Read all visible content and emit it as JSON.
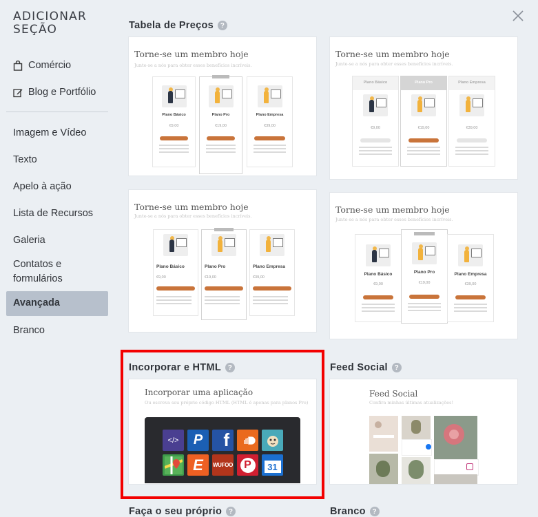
{
  "sidebar": {
    "title_line1": "ADICIONAR",
    "title_line2": "SEÇÃO",
    "links": [
      "Comércio",
      "Blog e Portfólio"
    ],
    "items": [
      "Imagem e Vídeo",
      "Texto",
      "Apelo à ação",
      "Lista de Recursos",
      "Galeria",
      "Contatos e formulários",
      "Avançada",
      "Branco"
    ],
    "active": "Avançada"
  },
  "sections": {
    "pricing": "Tabela de Preços",
    "embed": "Incorporar e HTML",
    "social": "Feed Social",
    "own": "Faça o seu próprio",
    "blank": "Branco"
  },
  "pricing_preview": {
    "title": "Torne-se um membro hoje",
    "subtitle": "Junte-se a nós para obter esses benefícios incríveis.",
    "plans": [
      {
        "name": "Plano Básico",
        "price": "€9,00"
      },
      {
        "name": "Plano Pro",
        "price": "€19,00"
      },
      {
        "name": "Plano Empresa",
        "price": "€39,00"
      }
    ],
    "button": "SELECIONAR"
  },
  "embed_preview": {
    "title": "Incorporar uma aplicação",
    "subtitle": "Ou escreva seu próprio código HTML (HTML é apenas para planos Pro)",
    "icons": [
      "code-icon",
      "paypal-icon",
      "facebook-icon",
      "soundcloud-icon",
      "mailchimp-icon",
      "google-maps-icon",
      "eventbrite-icon",
      "wufoo-icon",
      "pinterest-icon",
      "calendar-icon"
    ],
    "wufoo_label": "WUFOO",
    "calendar_day": "31",
    "eventbrite_letter": "E",
    "code_glyph": "</>",
    "paypal_letter": "P",
    "facebook_letter": "f",
    "pinterest_letter": "P"
  },
  "social_preview": {
    "title": "Feed Social",
    "subtitle": "Confira minhas últimas atualizações!"
  },
  "colors": {
    "highlight": "#f30000",
    "active_bg": "#b7c0cc",
    "button_orange": "#c9743a"
  }
}
